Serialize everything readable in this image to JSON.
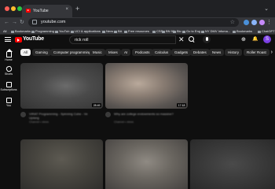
{
  "browser": {
    "tab_title": "YouTube",
    "tab_close": "×",
    "new_tab": "+",
    "tab_menu": "⌄",
    "url": "youtube.com",
    "nav": {
      "back": "←",
      "forward": "→",
      "reload": "↻"
    },
    "star": "☆",
    "menu": "⋮",
    "bookmarks": [
      "All",
      "Bookmarks",
      "Programming",
      "YouTub",
      "UCI & applications",
      "Nexs",
      "BA",
      "Free resources",
      "CSS",
      "BN 9th",
      "Bio",
      "Go to Eng",
      "NY DMV Infoma...",
      "Bookmarks",
      "ChatGPT"
    ],
    "traffic_colors": [
      "#ff5f57",
      "#febc2e",
      "#28c840"
    ]
  },
  "youtube": {
    "logo": "YouTube",
    "search_query": "rick roll",
    "search_clear": "✕",
    "header_icons": {
      "create": "⊕",
      "notifications": "🔔"
    },
    "avatar_letter": "S",
    "avatar_color": "#7b3fe4",
    "sidebar": [
      {
        "label": "Home",
        "icon": "home-icon"
      },
      {
        "label": "Shorts",
        "icon": "shorts-icon"
      },
      {
        "label": "Subscriptions",
        "icon": "subscriptions-icon"
      },
      {
        "label": "You",
        "icon": "you-icon"
      }
    ],
    "chips": [
      "All",
      "Gaming",
      "Computer programming",
      "Music",
      "Mixes",
      "AI",
      "Podcasts",
      "Calculus",
      "Gadgets",
      "Debates",
      "News",
      "History",
      "Roller Roast"
    ],
    "chips_next": "›",
    "videos": [
      {
        "duration": "28:49",
        "title": "VIRAT Programming - Spinning Cube - Ve Uplang",
        "meta": "Channel • views"
      },
      {
        "duration": "17:18",
        "title": "Why are college endowments so massive?",
        "meta": "Channel • views"
      }
    ]
  }
}
